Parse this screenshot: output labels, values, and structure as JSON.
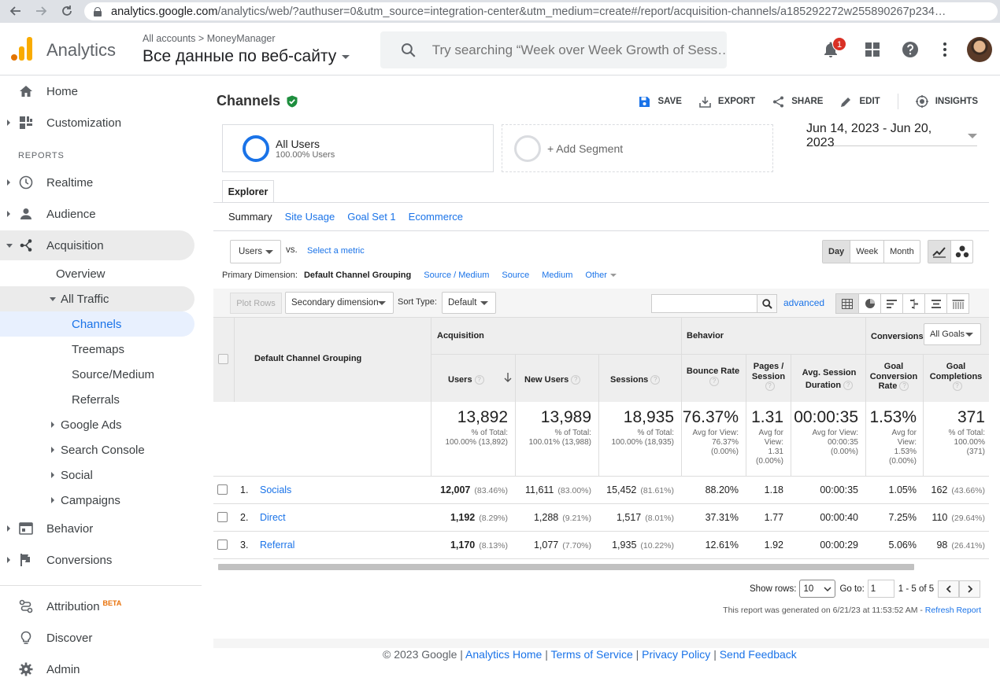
{
  "browser": {
    "url_host": "analytics.google.com",
    "url_path": "/analytics/web/?authuser=0&utm_source=integration-center&utm_medium=create#/report/acquisition-channels/a185292272w255890267p234…"
  },
  "header": {
    "app_name": "Analytics",
    "breadcrumb_all": "All accounts",
    "breadcrumb_sep": ">",
    "breadcrumb_account": "MoneyManager",
    "view_name": "Все данные по веб-сайту",
    "search_placeholder": "Try searching “Week over Week Growth of Sess…",
    "notification_count": "1"
  },
  "sidebar": {
    "home": "Home",
    "customization": "Customization",
    "reports_header": "REPORTS",
    "realtime": "Realtime",
    "audience": "Audience",
    "acquisition": "Acquisition",
    "overview": "Overview",
    "all_traffic": "All Traffic",
    "channels": "Channels",
    "treemaps": "Treemaps",
    "source_medium": "Source/Medium",
    "referrals": "Referrals",
    "google_ads": "Google Ads",
    "search_console": "Search Console",
    "social": "Social",
    "campaigns": "Campaigns",
    "behavior": "Behavior",
    "conversions": "Conversions",
    "attribution": "Attribution",
    "beta": "BETA",
    "discover": "Discover",
    "admin": "Admin"
  },
  "report": {
    "title": "Channels",
    "actions": {
      "save": "SAVE",
      "export": "EXPORT",
      "share": "SHARE",
      "edit": "EDIT",
      "insights": "INSIGHTS"
    },
    "segment": {
      "name": "All Users",
      "sub": "100.00% Users",
      "add": "+ Add Segment"
    },
    "date_range": "Jun 14, 2023 - Jun 20, 2023",
    "explorer_tab": "Explorer",
    "subtabs": {
      "summary": "Summary",
      "site_usage": "Site Usage",
      "goal_set": "Goal Set 1",
      "ecommerce": "Ecommerce"
    },
    "metric_select": "Users",
    "vs": "vs.",
    "select_metric": "Select a metric",
    "period": {
      "day": "Day",
      "week": "Week",
      "month": "Month"
    },
    "primary_dimension": {
      "label": "Primary Dimension:",
      "current": "Default Channel Grouping",
      "source_medium": "Source / Medium",
      "source": "Source",
      "medium": "Medium",
      "other": "Other"
    },
    "toolbar": {
      "plot_rows": "Plot Rows",
      "secondary_dimension": "Secondary dimension",
      "sort_type_label": "Sort Type:",
      "sort_type": "Default",
      "advanced": "advanced"
    }
  },
  "table": {
    "dimension_header": "Default Channel Grouping",
    "groups": {
      "acquisition": "Acquisition",
      "behavior": "Behavior",
      "conversions": "Conversions",
      "goal_select": "All Goals"
    },
    "columns": {
      "users": "Users",
      "new_users": "New Users",
      "sessions": "Sessions",
      "bounce_rate": "Bounce Rate",
      "pages_session_1": "Pages /",
      "pages_session_2": "Session",
      "avg_dur_1": "Avg. Session",
      "avg_dur_2": "Duration",
      "gcr_1": "Goal",
      "gcr_2": "Conversion",
      "gcr_3": "Rate",
      "gc_1": "Goal",
      "gc_2": "Completions"
    },
    "totals": {
      "users": {
        "value": "13,892",
        "l1": "% of Total:",
        "l2": "100.00% (13,892)"
      },
      "new_users": {
        "value": "13,989",
        "l1": "% of Total:",
        "l2": "100.01% (13,988)"
      },
      "sessions": {
        "value": "18,935",
        "l1": "% of Total:",
        "l2": "100.00% (18,935)"
      },
      "bounce_rate": {
        "value": "76.37%",
        "l1": "Avg for View:",
        "l2": "76.37%",
        "l3": "(0.00%)"
      },
      "pages_session": {
        "value": "1.31",
        "l1": "Avg for",
        "l2": "View:",
        "l3": "1.31",
        "l4": "(0.00%)"
      },
      "avg_duration": {
        "value": "00:00:35",
        "l1": "Avg for View:",
        "l2": "00:00:35",
        "l3": "(0.00%)"
      },
      "gcr": {
        "value": "1.53%",
        "l1": "Avg for",
        "l2": "View:",
        "l3": "1.53%",
        "l4": "(0.00%)"
      },
      "gc": {
        "value": "371",
        "l1": "% of Total:",
        "l2": "100.00%",
        "l3": "(371)"
      }
    },
    "rows": [
      {
        "idx": "1.",
        "name": "Socials",
        "users": "12,007",
        "users_pct": "(83.46%)",
        "new_users": "11,611",
        "new_users_pct": "(83.00%)",
        "sessions": "15,452",
        "sessions_pct": "(81.61%)",
        "bounce": "88.20%",
        "pages": "1.18",
        "duration": "00:00:35",
        "gcr": "1.05%",
        "gc": "162",
        "gc_pct": "(43.66%)"
      },
      {
        "idx": "2.",
        "name": "Direct",
        "users": "1,192",
        "users_pct": "(8.29%)",
        "new_users": "1,288",
        "new_users_pct": "(9.21%)",
        "sessions": "1,517",
        "sessions_pct": "(8.01%)",
        "bounce": "37.31%",
        "pages": "1.77",
        "duration": "00:00:40",
        "gcr": "7.25%",
        "gc": "110",
        "gc_pct": "(29.64%)"
      },
      {
        "idx": "3.",
        "name": "Referral",
        "users": "1,170",
        "users_pct": "(8.13%)",
        "new_users": "1,077",
        "new_users_pct": "(7.70%)",
        "sessions": "1,935",
        "sessions_pct": "(10.22%)",
        "bounce": "12.61%",
        "pages": "1.92",
        "duration": "00:00:29",
        "gcr": "5.06%",
        "gc": "98",
        "gc_pct": "(26.41%)"
      }
    ]
  },
  "pager": {
    "show_rows_label": "Show rows:",
    "show_rows": "10",
    "goto_label": "Go to:",
    "goto": "1",
    "range": "1 - 5 of 5"
  },
  "report_generated": "This report was generated on 6/21/23 at 11:53:52 AM -",
  "refresh": "Refresh Report",
  "footer": {
    "copyright": "© 2023 Google",
    "sep": "|",
    "home": "Analytics Home",
    "tos": "Terms of Service",
    "privacy": "Privacy Policy",
    "feedback": "Send Feedback"
  },
  "colors": {
    "accent": "#1a73e8",
    "brand_orange": "#f9ab00",
    "verified": "#1e8e3e",
    "badge": "#d93025"
  }
}
